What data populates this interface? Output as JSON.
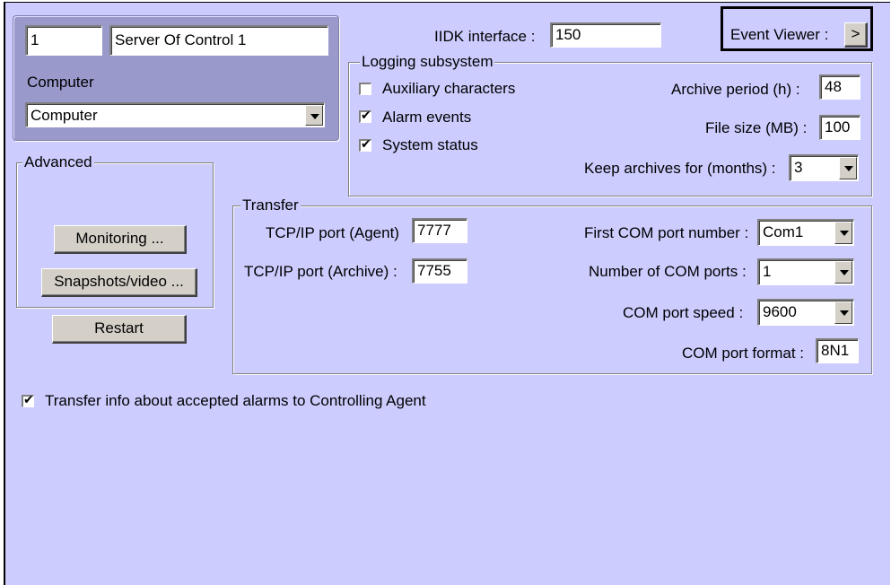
{
  "server": {
    "id": "1",
    "name": "Server Of Control 1",
    "computer_label": "Computer",
    "computer_value": "Computer"
  },
  "iidk": {
    "label": "IIDK interface :",
    "value": "150"
  },
  "event_viewer": {
    "label": "Event Viewer :",
    "button": ">"
  },
  "logging": {
    "title": "Logging subsystem",
    "aux_label": "Auxiliary characters",
    "aux_checked": false,
    "alarm_label": "Alarm events",
    "alarm_checked": true,
    "status_label": "System status",
    "status_checked": true,
    "archive_period_label": "Archive period (h) :",
    "archive_period_value": "48",
    "file_size_label": "File size (MB) :",
    "file_size_value": "100",
    "keep_label": "Keep archives for (months) :",
    "keep_value": "3"
  },
  "advanced": {
    "title": "Advanced",
    "monitoring": "Monitoring ...",
    "snapshots": "Snapshots/video ...",
    "restart": "Restart"
  },
  "transfer": {
    "title": "Transfer",
    "tcp_agent_label": "TCP/IP port (Agent)",
    "tcp_agent_value": "7777",
    "tcp_archive_label": "TCP/IP port (Archive) :",
    "tcp_archive_value": "7755",
    "first_com_label": "First COM port number :",
    "first_com_value": "Com1",
    "num_com_label": "Number of COM ports :",
    "num_com_value": "1",
    "com_speed_label": "COM port speed :",
    "com_speed_value": "9600",
    "com_format_label": "COM port format :",
    "com_format_value": "8N1"
  },
  "transfer_alarms": {
    "label": "Transfer info about accepted alarms to Controlling Agent",
    "checked": true
  },
  "check_glyph": "✔"
}
